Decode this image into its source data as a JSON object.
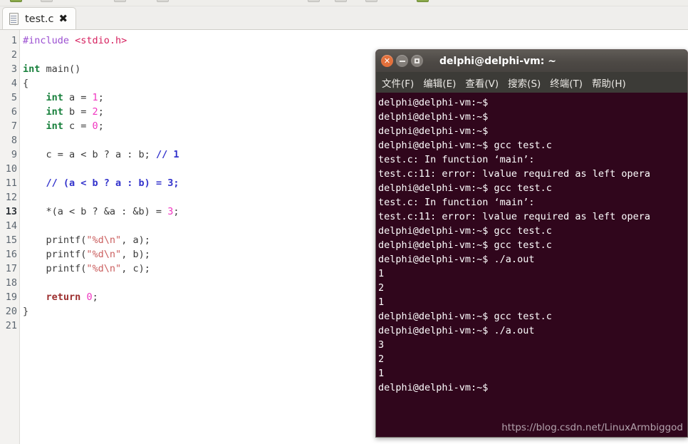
{
  "editor": {
    "tab": {
      "label": "test.c",
      "close_label": "✖",
      "icon": "document-icon"
    },
    "toolbar_icons": [
      "new-icon",
      "open-icon",
      "save-icon",
      "print-icon",
      "undo-icon",
      "redo-icon",
      "cut-icon",
      "copy-icon",
      "paste-icon",
      "find-icon"
    ],
    "current_line": 13,
    "line_count": 21,
    "lines": [
      {
        "n": 1,
        "tokens": [
          {
            "t": "#include ",
            "c": "tok-pre"
          },
          {
            "t": "<stdio.h>",
            "c": "tok-hdr"
          }
        ]
      },
      {
        "n": 2,
        "tokens": []
      },
      {
        "n": 3,
        "tokens": [
          {
            "t": "int",
            "c": "tok-kw"
          },
          {
            "t": " main()",
            "c": "tok-plain"
          }
        ]
      },
      {
        "n": 4,
        "tokens": [
          {
            "t": "{",
            "c": "tok-plain"
          }
        ]
      },
      {
        "n": 5,
        "tokens": [
          {
            "t": "    ",
            "c": "tok-plain"
          },
          {
            "t": "int",
            "c": "tok-kw"
          },
          {
            "t": " a = ",
            "c": "tok-plain"
          },
          {
            "t": "1",
            "c": "tok-num"
          },
          {
            "t": ";",
            "c": "tok-plain"
          }
        ]
      },
      {
        "n": 6,
        "tokens": [
          {
            "t": "    ",
            "c": "tok-plain"
          },
          {
            "t": "int",
            "c": "tok-kw"
          },
          {
            "t": " b = ",
            "c": "tok-plain"
          },
          {
            "t": "2",
            "c": "tok-num"
          },
          {
            "t": ";",
            "c": "tok-plain"
          }
        ]
      },
      {
        "n": 7,
        "tokens": [
          {
            "t": "    ",
            "c": "tok-plain"
          },
          {
            "t": "int",
            "c": "tok-kw"
          },
          {
            "t": " c = ",
            "c": "tok-plain"
          },
          {
            "t": "0",
            "c": "tok-num"
          },
          {
            "t": ";",
            "c": "tok-plain"
          }
        ]
      },
      {
        "n": 8,
        "tokens": []
      },
      {
        "n": 9,
        "tokens": [
          {
            "t": "    c = a < b ? a : b; ",
            "c": "tok-plain"
          },
          {
            "t": "// 1",
            "c": "tok-cmt"
          }
        ]
      },
      {
        "n": 10,
        "tokens": []
      },
      {
        "n": 11,
        "tokens": [
          {
            "t": "    ",
            "c": "tok-plain"
          },
          {
            "t": "// (a < b ? a : b) = 3;",
            "c": "tok-cmt"
          }
        ]
      },
      {
        "n": 12,
        "tokens": []
      },
      {
        "n": 13,
        "tokens": [
          {
            "t": "    *(a < b ? &a : &b) = ",
            "c": "tok-plain"
          },
          {
            "t": "3",
            "c": "tok-num"
          },
          {
            "t": ";",
            "c": "tok-plain"
          }
        ]
      },
      {
        "n": 14,
        "tokens": []
      },
      {
        "n": 15,
        "tokens": [
          {
            "t": "    printf(",
            "c": "tok-plain"
          },
          {
            "t": "\"%d\\n\"",
            "c": "tok-str"
          },
          {
            "t": ", a);",
            "c": "tok-plain"
          }
        ]
      },
      {
        "n": 16,
        "tokens": [
          {
            "t": "    printf(",
            "c": "tok-plain"
          },
          {
            "t": "\"%d\\n\"",
            "c": "tok-str"
          },
          {
            "t": ", b);",
            "c": "tok-plain"
          }
        ]
      },
      {
        "n": 17,
        "tokens": [
          {
            "t": "    printf(",
            "c": "tok-plain"
          },
          {
            "t": "\"%d\\n\"",
            "c": "tok-str"
          },
          {
            "t": ", c);",
            "c": "tok-plain"
          }
        ]
      },
      {
        "n": 18,
        "tokens": []
      },
      {
        "n": 19,
        "tokens": [
          {
            "t": "    ",
            "c": "tok-plain"
          },
          {
            "t": "return",
            "c": "tok-kw2"
          },
          {
            "t": " ",
            "c": "tok-plain"
          },
          {
            "t": "0",
            "c": "tok-num"
          },
          {
            "t": ";",
            "c": "tok-plain"
          }
        ]
      },
      {
        "n": 20,
        "tokens": [
          {
            "t": "}",
            "c": "tok-plain"
          }
        ]
      },
      {
        "n": 21,
        "tokens": []
      }
    ]
  },
  "terminal": {
    "title": "delphi@delphi-vm: ~",
    "window_buttons": {
      "close": {
        "name": "close-window-button",
        "glyph": "✕",
        "color": "#e3703b"
      },
      "minimize": {
        "name": "minimize-window-button",
        "color": "#837e79"
      },
      "maximize": {
        "name": "maximize-window-button",
        "color": "#837e79"
      }
    },
    "menu": [
      {
        "name": "menu-file",
        "label": "文件(F)"
      },
      {
        "name": "menu-edit",
        "label": "编辑(E)"
      },
      {
        "name": "menu-view",
        "label": "查看(V)"
      },
      {
        "name": "menu-search",
        "label": "搜索(S)"
      },
      {
        "name": "menu-terminal",
        "label": "终端(T)"
      },
      {
        "name": "menu-help",
        "label": "帮助(H)"
      }
    ],
    "background_color": "#30061c",
    "text_color": "#ffffff",
    "lines": [
      "delphi@delphi-vm:~$",
      "delphi@delphi-vm:~$",
      "delphi@delphi-vm:~$",
      "delphi@delphi-vm:~$ gcc test.c",
      "test.c: In function ‘main’:",
      "test.c:11: error: lvalue required as left opera",
      "delphi@delphi-vm:~$ gcc test.c",
      "test.c: In function ‘main’:",
      "test.c:11: error: lvalue required as left opera",
      "delphi@delphi-vm:~$ gcc test.c",
      "delphi@delphi-vm:~$ gcc test.c",
      "delphi@delphi-vm:~$ ./a.out",
      "1",
      "2",
      "1",
      "delphi@delphi-vm:~$ gcc test.c",
      "delphi@delphi-vm:~$ ./a.out",
      "3",
      "2",
      "1",
      "delphi@delphi-vm:~$"
    ]
  },
  "watermark": "https://blog.csdn.net/LinuxArmbiggod"
}
